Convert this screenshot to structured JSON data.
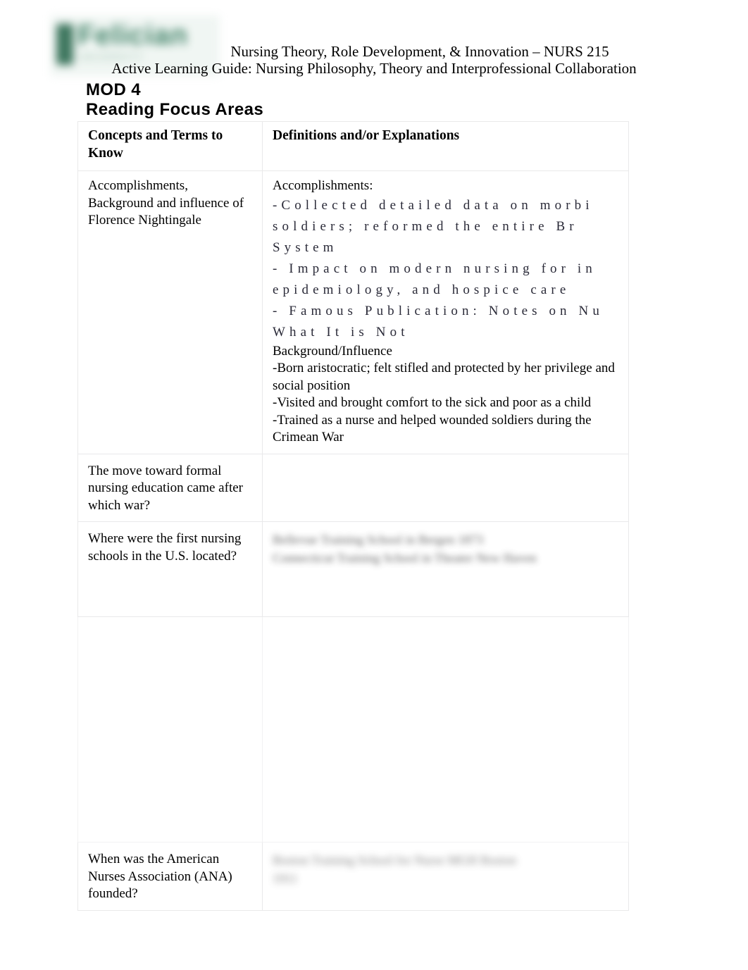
{
  "document": {
    "logo": {
      "word": "Felician",
      "subtitle": "UNIVERSITY",
      "color": "#31795b"
    },
    "header": {
      "course_line": "Nursing Theory, Role Development, & Innovation  – NURS 215",
      "guide_line": "Active Learning Guide: Nursing Philosophy, Theory and Interprofessional Collaboration"
    },
    "mod_title": "MOD 4",
    "section_title": "Reading Focus Areas"
  },
  "table": {
    "headers": {
      "col1": "Concepts and Terms to Know",
      "col2": "Definitions and/or Explanations"
    },
    "rows": [
      {
        "concept": "Accomplishments, Background and influence of Florence Nightingale",
        "answer": {
          "heading": "Accomplishments:",
          "stretched_lines": [
            "-Collected detailed data on morbi",
            "soldiers; reformed the entire Br",
            "System",
            "- Impact on modern nursing for in",
            "epidemiology, and hospice care",
            "- Famous Publication: Notes on Nu",
            "What It is Not"
          ],
          "subheading": "Background/Influence",
          "plain_lines": [
            "-Born aristocratic; felt stifled and protected by her privilege and social position",
            "-Visited and brought comfort to the sick and poor as a child",
            "-Trained as a nurse and helped wounded soldiers during the Crimean War"
          ]
        }
      },
      {
        "concept": "The move toward formal nursing education came after which war?",
        "answer": {
          "blurred_lines": []
        }
      },
      {
        "concept": "Where were the first nursing schools in the U.S. located?",
        "answer": {
          "blurred_lines": [
            "Bellevue Training School in Bergen 1873",
            "Connecticut Training School in Theater New Haven"
          ]
        }
      },
      {
        "concept": "",
        "answer": {
          "blurred_lines": []
        }
      },
      {
        "concept": "When was the American Nurses Association (ANA) founded?",
        "answer": {
          "blurred_lines": [
            "Boston Training School for Nurse  MGH  Boston",
            "1911"
          ]
        }
      }
    ]
  }
}
